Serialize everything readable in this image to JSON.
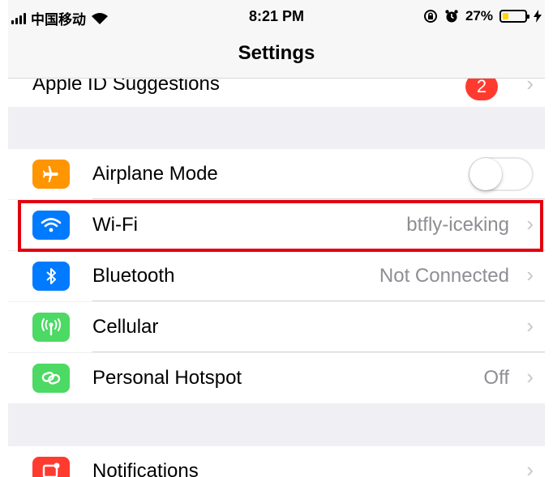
{
  "status_bar": {
    "carrier": "中国移动",
    "time": "8:21 PM",
    "battery_percent": "27%",
    "battery_level": 0.27,
    "icons": [
      "signal-icon",
      "wifi-icon",
      "rotation-lock-icon",
      "alarm-icon",
      "battery-icon",
      "charging-icon"
    ]
  },
  "nav": {
    "title": "Settings"
  },
  "apple_id": {
    "label": "Apple ID Suggestions",
    "badge": "2"
  },
  "network_section": [
    {
      "id": "airplane",
      "label": "Airplane Mode",
      "icon": "airplane-icon",
      "icon_color": "#ff9500",
      "control": "toggle",
      "toggle_on": false
    },
    {
      "id": "wifi",
      "label": "Wi-Fi",
      "icon": "wifi-icon",
      "icon_color": "#007aff",
      "value": "btfly-iceking",
      "highlighted": true
    },
    {
      "id": "bluetooth",
      "label": "Bluetooth",
      "icon": "bluetooth-icon",
      "icon_color": "#007aff",
      "value": "Not Connected"
    },
    {
      "id": "cellular",
      "label": "Cellular",
      "icon": "cellular-antenna-icon",
      "icon_color": "#4cd964"
    },
    {
      "id": "hotspot",
      "label": "Personal Hotspot",
      "icon": "hotspot-link-icon",
      "icon_color": "#4cd964",
      "value": "Off"
    }
  ],
  "notifications": {
    "label": "Notifications",
    "icon": "notifications-icon",
    "icon_color": "#ff3b30"
  },
  "highlight_color": "#e3000f"
}
